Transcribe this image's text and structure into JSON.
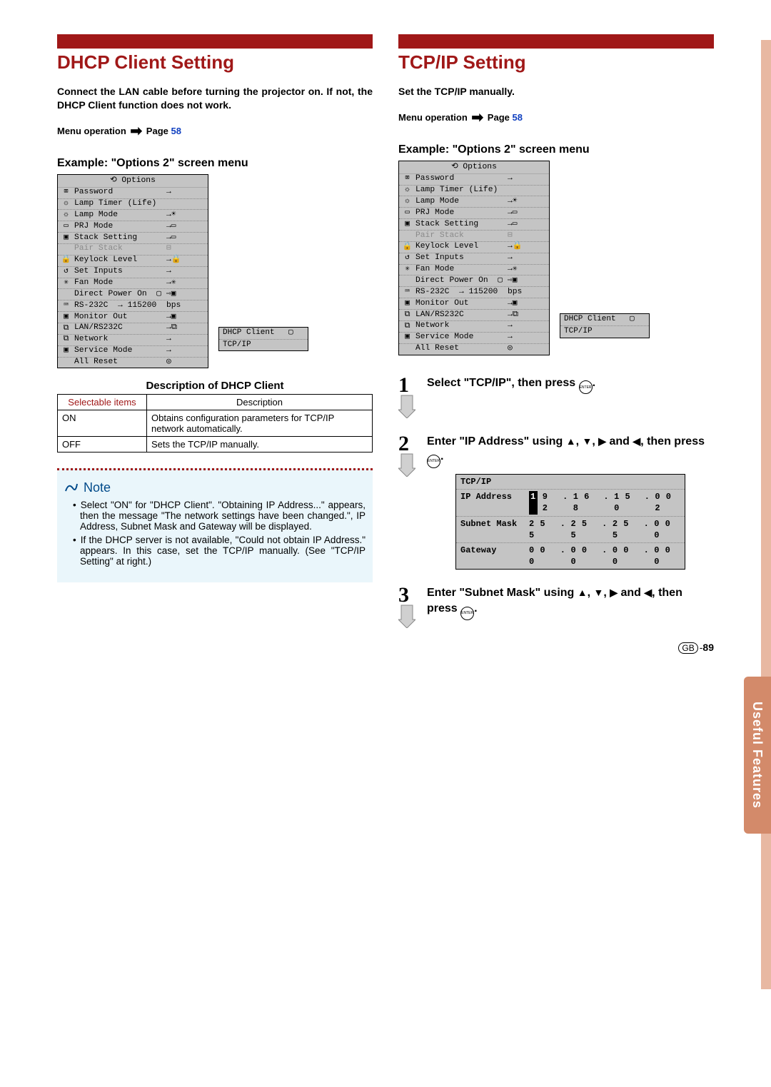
{
  "left": {
    "title": "DHCP Client Setting",
    "intro": "Connect the LAN cable before turning the pro­jector on. If not, the DHCP Client function does not work.",
    "menu_op_prefix": "Menu operation",
    "menu_op_page": "Page ",
    "menu_op_num": "58",
    "example": "Example: \"Options 2\" screen menu",
    "desc_heading": "Description of DHCP Client",
    "table": {
      "h1": "Selectable items",
      "h2": "Description",
      "r1c1": "ON",
      "r1c2": "Obtains configuration parameters for TCP/IP network automatically.",
      "r2c1": "OFF",
      "r2c2": "Sets the TCP/IP manually."
    },
    "note_title": "Note",
    "note_items": [
      "Select \"ON\" for \"DHCP Client\". \"Obtaining IP Address...\" appears, then the message \"The network settings have been changed.\", IP Address, Subnet Mask and Gateway will be displayed.",
      "If the DHCP server is not available, \"Could not obtain IP Address.\" appears.\nIn this case, set the TCP/IP manually. (See \"TCP/IP Setting\" at right.)"
    ]
  },
  "right": {
    "title": "TCP/IP Setting",
    "intro": "Set the TCP/IP manually.",
    "menu_op_prefix": "Menu operation",
    "menu_op_page": "Page ",
    "menu_op_num": "58",
    "example": "Example: \"Options 2\" screen menu",
    "steps": {
      "s1": "Select \"TCP/IP\", then press ",
      "s2a": "Enter \"IP Address\" using ",
      "s2b": " and ",
      "s2c": ", then press ",
      "s3a": "Enter \"Subnet Mask\" using ",
      "s3b": " and ",
      "s3c": ", then press "
    },
    "tcpip": {
      "title": "TCP/IP",
      "ip_label": "IP Address",
      "ip_vals": [
        "1",
        "9 2",
        ".",
        "1 6 8",
        ".",
        "1 5 0",
        ".",
        "0 0 2"
      ],
      "sm_label": "Subnet Mask",
      "sm_vals": [
        "2 5 5",
        ".",
        "2 5 5",
        ".",
        "2 5 5",
        ".",
        "0 0 0"
      ],
      "gw_label": "Gateway",
      "gw_vals": [
        "0 0 0",
        ".",
        "0 0 0",
        ".",
        "0 0 0",
        ".",
        "0 0 0"
      ]
    }
  },
  "options_menu": {
    "header": "Options",
    "rows": [
      {
        "icon": "⌧",
        "label": "Password",
        "val": "→"
      },
      {
        "icon": "☼",
        "label": "Lamp Timer (Life)",
        "val": ""
      },
      {
        "icon": "☼",
        "label": "Lamp Mode",
        "val": "→☀"
      },
      {
        "icon": "▭",
        "label": "PRJ Mode",
        "val": "→▭"
      },
      {
        "icon": "▣",
        "label": "Stack Setting",
        "val": "→▭"
      },
      {
        "icon": "",
        "label": "Pair Stack",
        "val": "⊟",
        "dim": true
      },
      {
        "icon": "🔒",
        "label": "Keylock Level",
        "val": "→🔒"
      },
      {
        "icon": "↺",
        "label": "Set Inputs",
        "val": "→"
      },
      {
        "icon": "✳",
        "label": "Fan Mode",
        "val": "→✳"
      },
      {
        "icon": "",
        "label": "Direct Power On  ▢",
        "val": "⇨▣"
      },
      {
        "icon": "⌨",
        "label": "RS-232C  → 115200",
        "val": "bps"
      },
      {
        "icon": "▣",
        "label": "Monitor Out",
        "val": "→▣"
      },
      {
        "icon": "⧉",
        "label": "LAN/RS232C",
        "val": "→⧉"
      },
      {
        "icon": "⧉",
        "label": "Network",
        "val": "→"
      },
      {
        "icon": "▣",
        "label": "Service Mode",
        "val": "→"
      },
      {
        "icon": "",
        "label": "All Reset",
        "val": "◎"
      }
    ],
    "submenu": [
      {
        "label": "DHCP Client",
        "val": "▢"
      },
      {
        "label": "TCP/IP",
        "val": ""
      }
    ]
  },
  "side_tab": "Useful Features",
  "footer": {
    "gb": "GB",
    "dash": "-",
    "page": "89"
  }
}
